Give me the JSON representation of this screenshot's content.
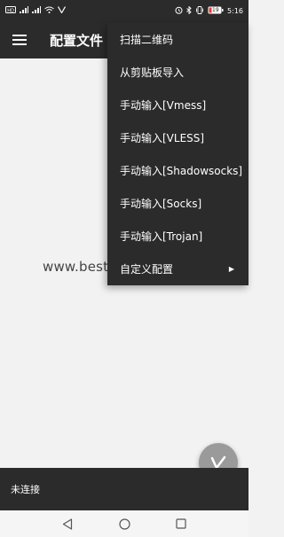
{
  "status_bar": {
    "left_icons": [
      "hd-icon",
      "signal-icon",
      "signal-icon",
      "wifi-icon",
      "vpn-icon"
    ],
    "right_icons": [
      "alarm-icon",
      "bluetooth-icon",
      "vibrate-icon",
      "battery-icon"
    ],
    "battery_level": "19",
    "time": "5:16"
  },
  "app_bar": {
    "title": "配置文件"
  },
  "menu": {
    "items": [
      {
        "label": "扫描二维码"
      },
      {
        "label": "从剪贴板导入"
      },
      {
        "label": "手动输入[Vmess]"
      },
      {
        "label": "手动输入[VLESS]"
      },
      {
        "label": "手动输入[Shadowsocks]"
      },
      {
        "label": "手动输入[Socks]"
      },
      {
        "label": "手动输入[Trojan]"
      },
      {
        "label": "自定义配置"
      }
    ]
  },
  "watermark": "www.bestvpnforchina.net",
  "bottom_status": {
    "text": "未连接"
  },
  "colors": {
    "bar": "#2b2b2b",
    "fab": "#9a9a9a",
    "content_bg": "#f2f2f2"
  }
}
